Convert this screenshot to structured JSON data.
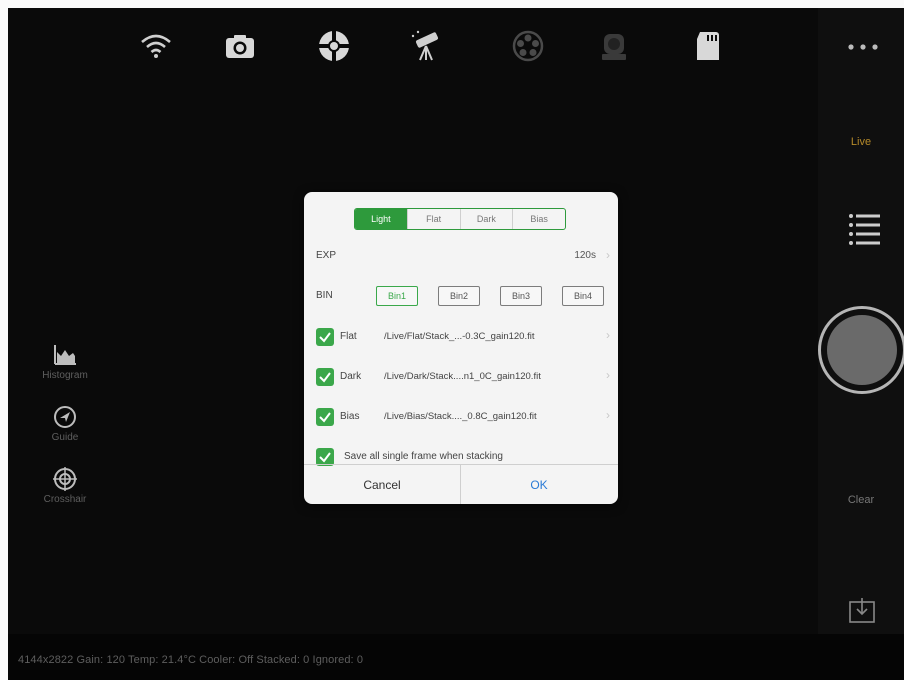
{
  "toolbar": {
    "icons": [
      "wifi-icon",
      "camera-icon",
      "lifebuoy-icon",
      "telescope-icon",
      "filter-wheel-icon",
      "focuser-icon",
      "sd-card-icon"
    ]
  },
  "right_panel": {
    "live_label": "Live",
    "clear_label": "Clear"
  },
  "left_tools": {
    "histogram_label": "Histogram",
    "guide_label": "Guide",
    "crosshair_label": "Crosshair"
  },
  "dialog": {
    "tabs": [
      {
        "label": "Light",
        "active": true
      },
      {
        "label": "Flat",
        "active": false
      },
      {
        "label": "Dark",
        "active": false
      },
      {
        "label": "Bias",
        "active": false
      }
    ],
    "exp_label": "EXP",
    "exp_value": "120s",
    "bin_label": "BIN",
    "bin_options": [
      {
        "label": "Bin1",
        "selected": true
      },
      {
        "label": "Bin2",
        "selected": false
      },
      {
        "label": "Bin3",
        "selected": false
      },
      {
        "label": "Bin4",
        "selected": false
      }
    ],
    "flat": {
      "label": "Flat",
      "checked": true,
      "path": "/Live/Flat/Stack_...-0.3C_gain120.fit"
    },
    "dark": {
      "label": "Dark",
      "checked": true,
      "path": "/Live/Dark/Stack....n1_0C_gain120.fit"
    },
    "bias": {
      "label": "Bias",
      "checked": true,
      "path": "/Live/Bias/Stack...._0.8C_gain120.fit"
    },
    "save_single": {
      "label": "Save all single frame when stacking",
      "checked": true
    },
    "cancel_label": "Cancel",
    "ok_label": "OK"
  },
  "status_bar": {
    "text": "4144x2822  Gain: 120  Temp: 21.4°C  Cooler: Off  Stacked: 0  Ignored: 0"
  },
  "colors": {
    "accent_green": "#2e9a3c",
    "ok_blue": "#2a7bd6",
    "live_gold": "#b58a2a"
  }
}
